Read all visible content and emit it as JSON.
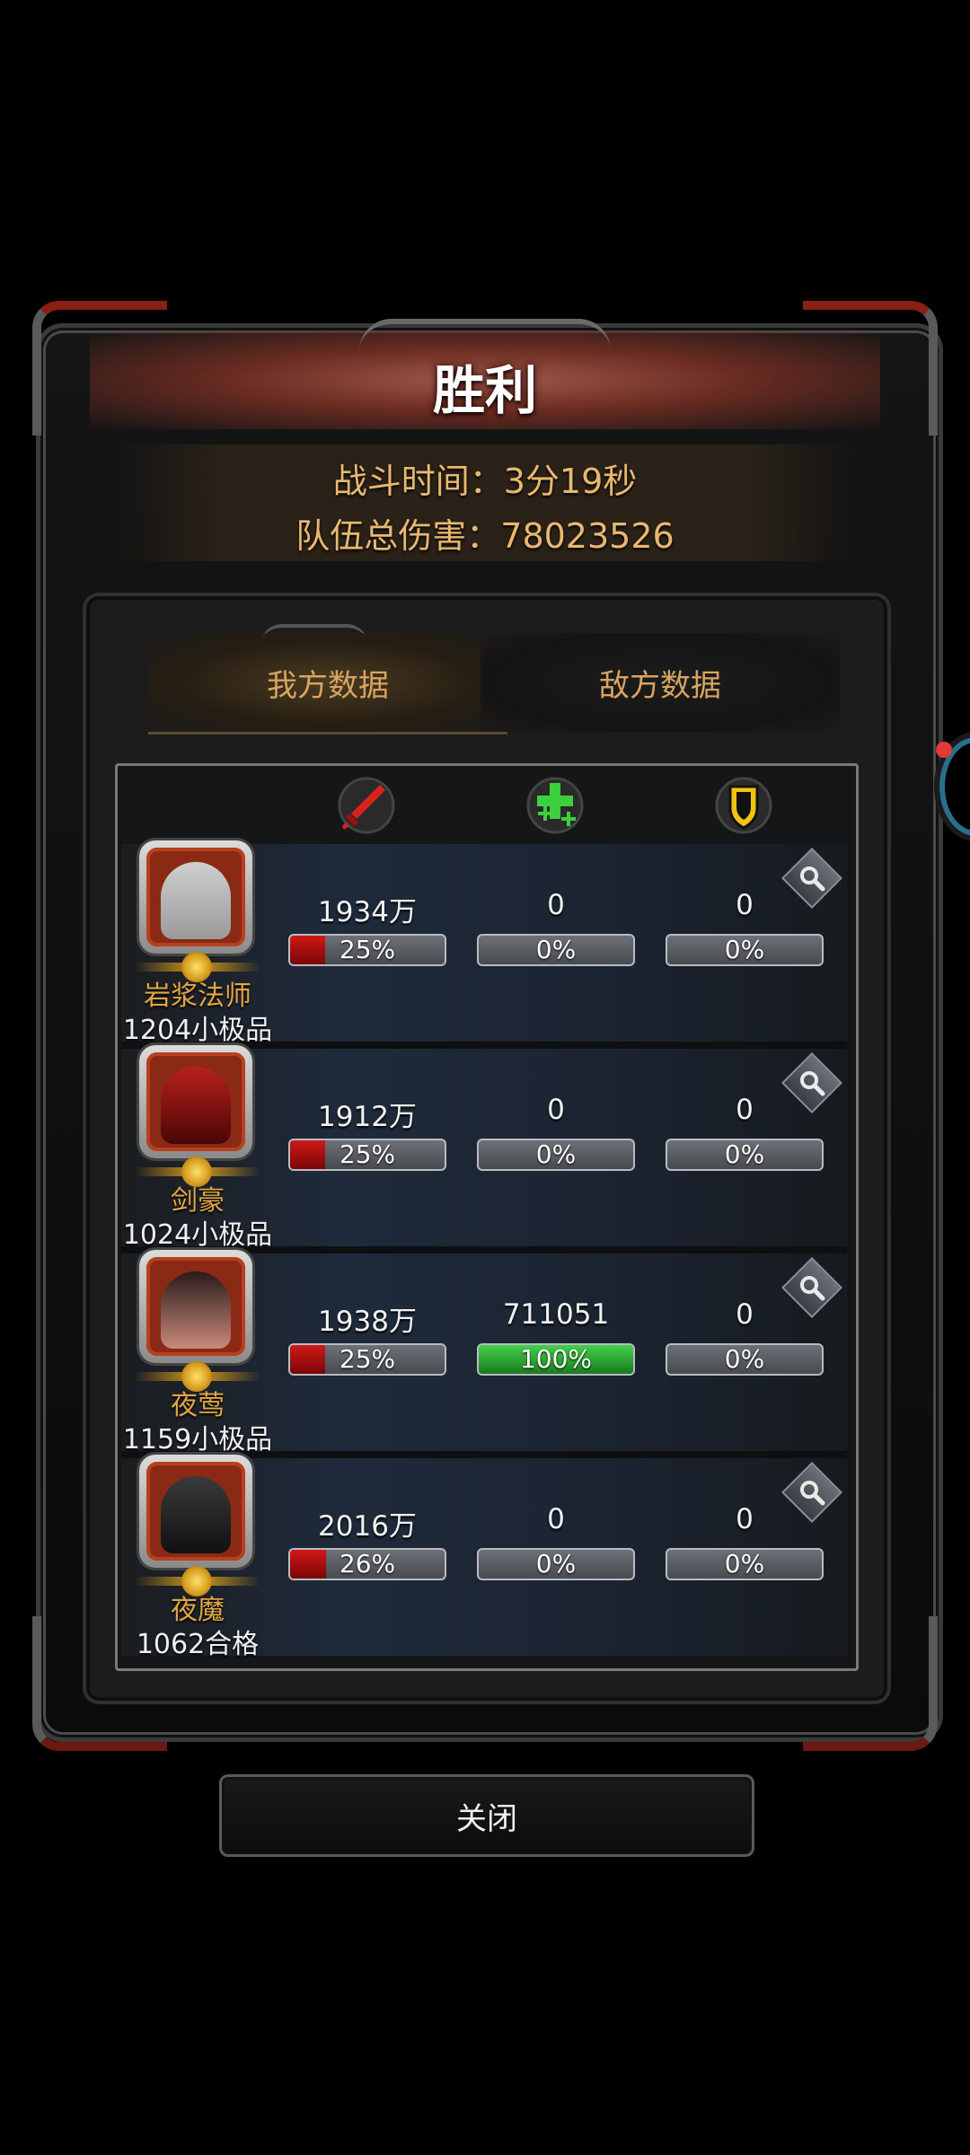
{
  "dialog": {
    "title": "胜利",
    "battle_time": "战斗时间：3分19秒",
    "team_damage": "队伍总伤害：78023526"
  },
  "tabs": [
    {
      "label": "我方数据",
      "active": true
    },
    {
      "label": "敌方数据",
      "active": false
    }
  ],
  "columns": [
    {
      "icon": "sword-icon",
      "color": "#d9221c"
    },
    {
      "icon": "heal-cross-icon",
      "color": "#3cd13c"
    },
    {
      "icon": "shield-icon",
      "color": "#f1c40f"
    }
  ],
  "heroes": [
    {
      "name": "岩浆法师",
      "power": "1204小极品",
      "damage": "1934万",
      "damage_pct": "25%",
      "damage_fill": 0.25,
      "heal": "0",
      "heal_pct": "0%",
      "heal_fill": 0,
      "tank": "0",
      "tank_pct": "0%",
      "tank_fill": 0,
      "portrait": "silver-haired-elf-portrait"
    },
    {
      "name": "剑豪",
      "power": "1024小极品",
      "damage": "1912万",
      "damage_pct": "25%",
      "damage_fill": 0.25,
      "heal": "0",
      "heal_pct": "0%",
      "heal_fill": 0,
      "tank": "0",
      "tank_pct": "0%",
      "tank_fill": 0,
      "portrait": "red-demon-helm-portrait"
    },
    {
      "name": "夜莺",
      "power": "1159小极品",
      "damage": "1938万",
      "damage_pct": "25%",
      "damage_fill": 0.25,
      "heal": "711051",
      "heal_pct": "100%",
      "heal_fill": 1.0,
      "tank": "0",
      "tank_pct": "0%",
      "tank_fill": 0,
      "portrait": "hooded-girl-portrait"
    },
    {
      "name": "夜魔",
      "power": "1062合格",
      "damage": "2016万",
      "damage_pct": "26%",
      "damage_fill": 0.26,
      "heal": "0",
      "heal_pct": "0%",
      "heal_fill": 0,
      "tank": "0",
      "tank_pct": "0%",
      "tank_fill": 0,
      "portrait": "masked-ninja-portrait"
    }
  ],
  "close_label": "关闭"
}
